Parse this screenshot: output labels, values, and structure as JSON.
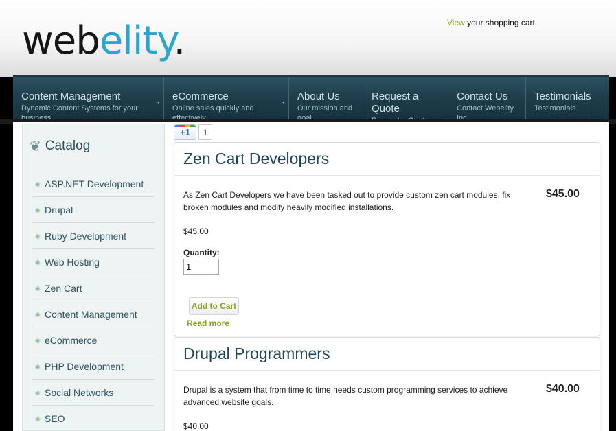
{
  "brand": {
    "logo_part1": "web",
    "logo_part2": "elity",
    "logo_part3": "."
  },
  "cart": {
    "view": "View",
    "rest": " your shopping cart."
  },
  "nav": [
    {
      "title": "Content Management",
      "sub": "Dynamic Content Systems for your business",
      "dot": "•"
    },
    {
      "title": "eCommerce",
      "sub": "Online sales quickly and effectively",
      "dot": "•"
    },
    {
      "title": "About Us",
      "sub": "Our mission and goal"
    },
    {
      "title": "Request a Quote",
      "sub": "Request a Quote"
    },
    {
      "title": "Contact Us",
      "sub": "Contact Webelity Inc."
    },
    {
      "title": "Testimonials",
      "sub": "Testimonials"
    }
  ],
  "sidebar": {
    "title": "Catalog",
    "items": [
      "ASP.NET Development",
      "Drupal",
      "Ruby Development",
      "Web Hosting",
      "Zen Cart",
      "Content Management",
      "eCommerce",
      "PHP Development",
      "Social Networks",
      "SEO"
    ]
  },
  "plusone": {
    "label": "+1",
    "count": "1"
  },
  "products": [
    {
      "title": "Zen Cart Developers",
      "description": "As Zen Cart Developers we have been tasked out to provide custom zen cart modules, fix broken modules and modify heavily modified installations.",
      "price_big": "$45.00",
      "price_small": "$45.00",
      "quantity_label": "Quantity:",
      "quantity_value": "1",
      "add_to_cart": "Add to Cart",
      "read_more": "Read more"
    },
    {
      "title": "Drupal Programmers",
      "description": "Drupal is a system that from time to time needs custom programming services to achieve advanced website goals.",
      "price_big": "$40.00",
      "price_small": "$40.00"
    }
  ],
  "colors": {
    "accent": "#2ba5cf",
    "link_green": "#8aa320",
    "nav_bg": "#1f3d4b"
  }
}
